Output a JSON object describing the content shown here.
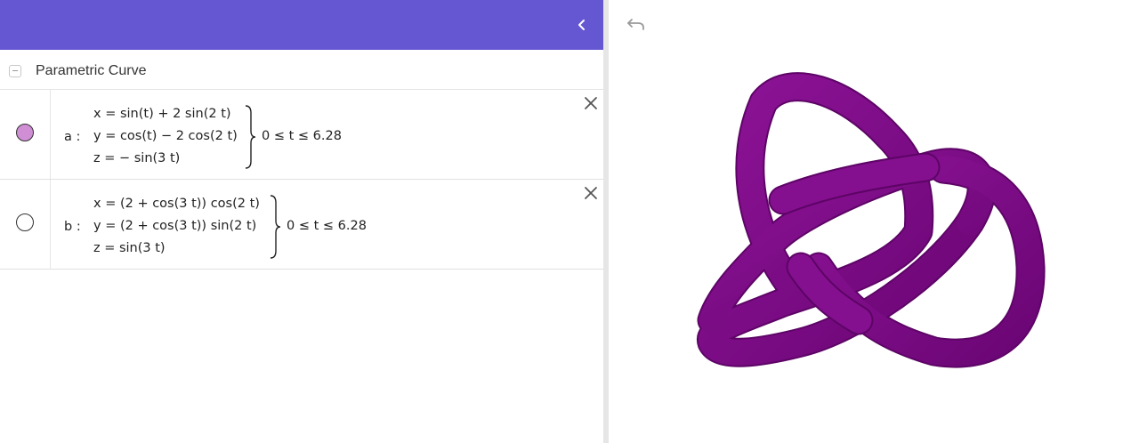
{
  "algebra_view": {
    "group_title": "Parametric Curve",
    "items": [
      {
        "label": "a :",
        "x_eq": "x = sin(t) + 2  sin(2 t)",
        "y_eq": "y = cos(t) − 2  cos(2 t)",
        "z_eq": "z = − sin(3 t)",
        "condition": "0 ≤ t ≤ 6.28",
        "visible": true,
        "marble_color": "#d08ed4"
      },
      {
        "label": "b :",
        "x_eq": "x = (2 + cos(3 t))  cos(2 t)",
        "y_eq": "y = (2 + cos(3 t))  sin(2 t)",
        "z_eq": "z = sin(3 t)",
        "condition": "0 ≤ t ≤ 6.28",
        "visible": false,
        "marble_color": "#ffffff"
      }
    ]
  },
  "graphics_view": {
    "curve_color": "#7d0a86",
    "icons": [
      "chevron-left-icon",
      "undo-icon",
      "close-icon"
    ]
  },
  "colors": {
    "header": "#6557d2"
  }
}
